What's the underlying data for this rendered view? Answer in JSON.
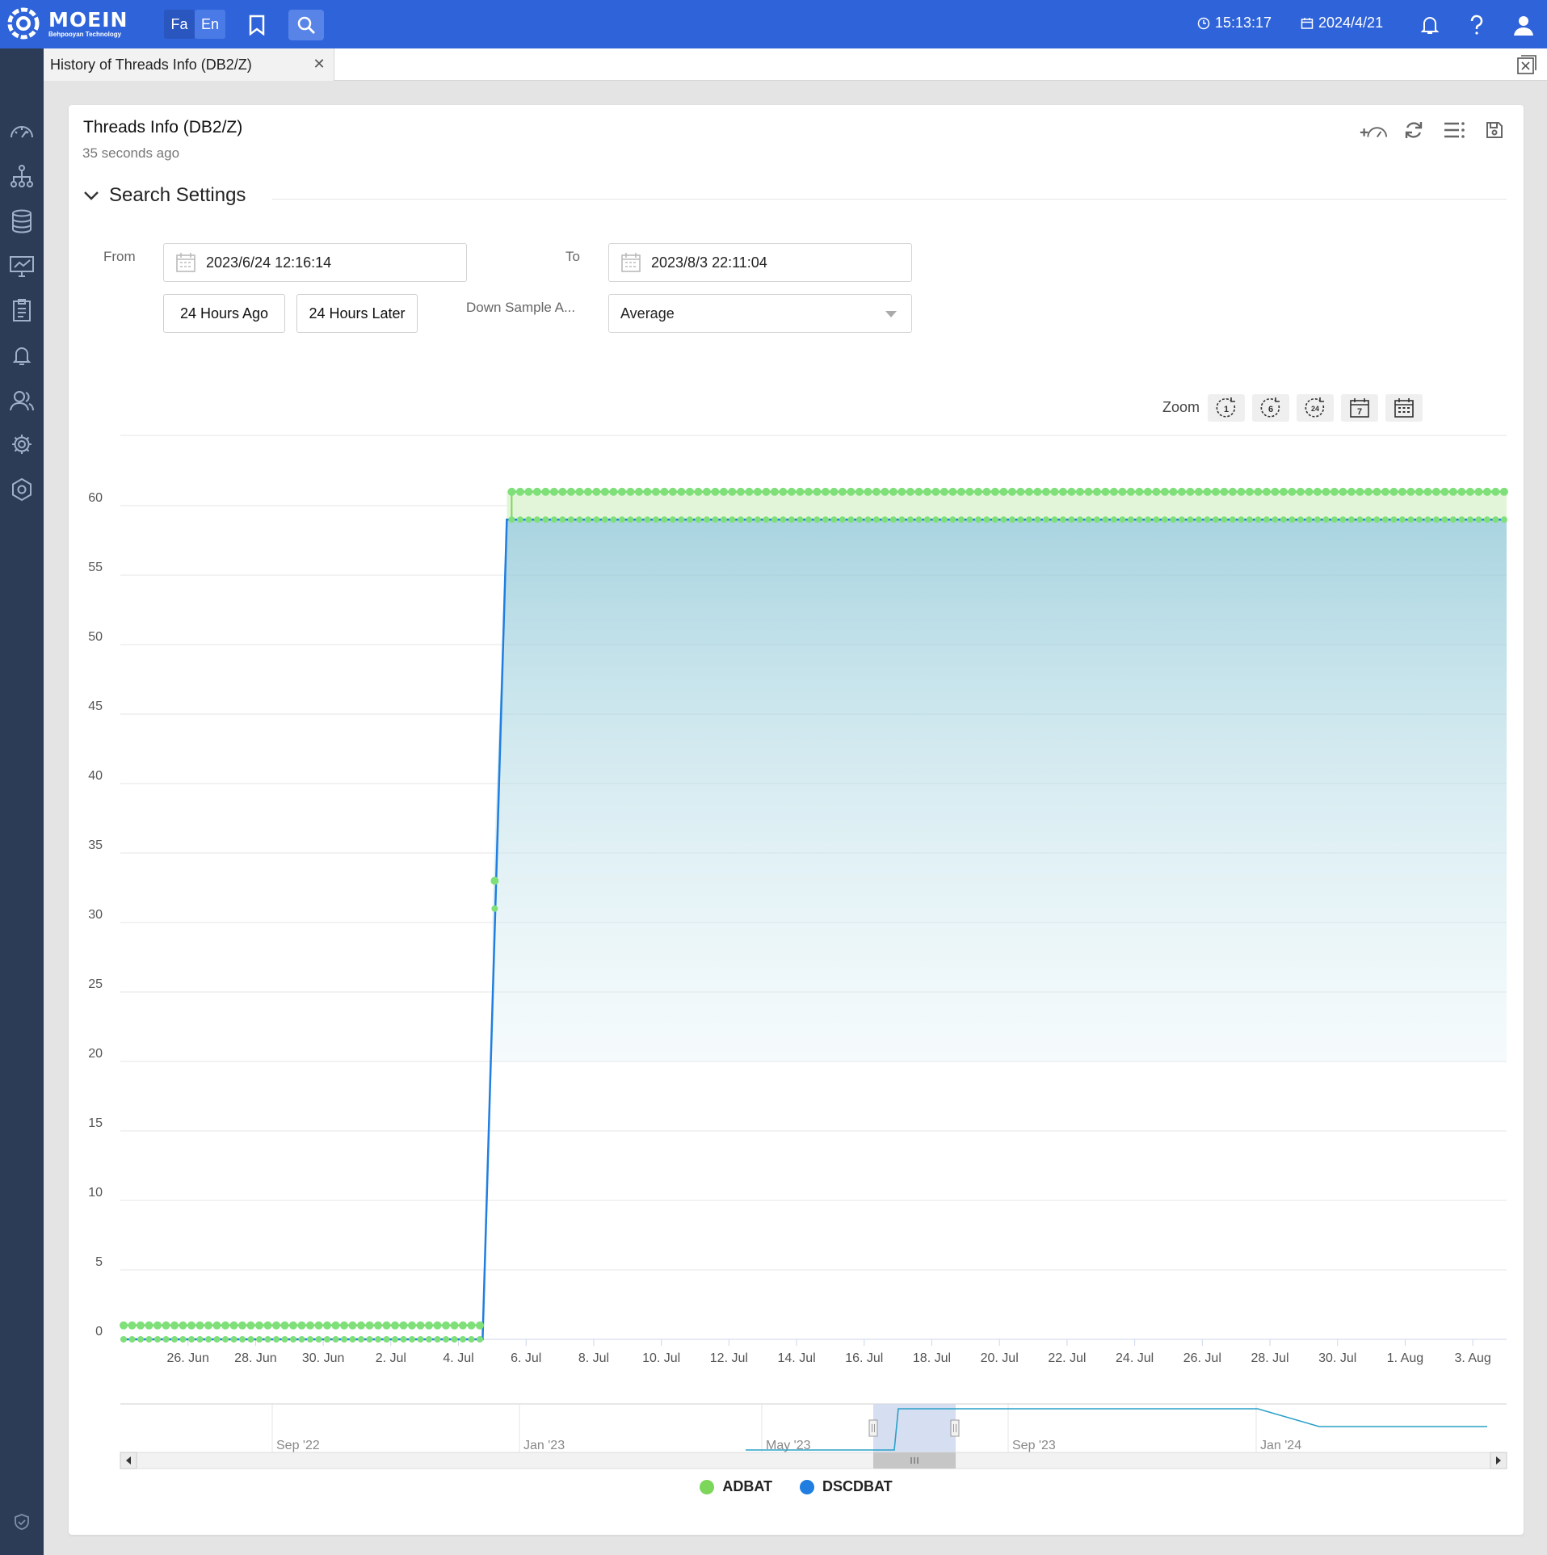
{
  "app": {
    "brand_name": "MOEIN",
    "brand_sub": "Behpooyan Technology",
    "lang_fa": "Fa",
    "lang_en": "En",
    "time": "15:13:17",
    "date": "2024/4/21"
  },
  "tab": {
    "title": "History of Threads Info (DB2/Z)"
  },
  "panel": {
    "title": "Threads Info (DB2/Z)",
    "subtitle": "35 seconds ago",
    "section_title": "Search Settings",
    "from_label": "From",
    "from_value": "2023/6/24 12:16:14",
    "to_label": "To",
    "to_value": "2023/8/3 22:11:04",
    "btn_ago": "24 Hours Ago",
    "btn_later": "24 Hours Later",
    "downsample_label": "Down Sample A...",
    "downsample_value": "Average",
    "zoom_label": "Zoom"
  },
  "colors": {
    "primary": "#2f63d9",
    "sidebar": "#2c3c57",
    "adbat": "#7bd65a",
    "dscdbat": "#1f7ee0"
  },
  "chart_data": {
    "type": "area",
    "title": "",
    "xlabel": "",
    "ylabel": "",
    "ylim": [
      0,
      65
    ],
    "yticks": [
      "0",
      "5",
      "10",
      "15",
      "20",
      "25",
      "30",
      "35",
      "40",
      "45",
      "50",
      "55",
      "60"
    ],
    "xticks": [
      "26. Jun",
      "28. Jun",
      "30. Jun",
      "2. Jul",
      "4. Jul",
      "6. Jul",
      "8. Jul",
      "10. Jul",
      "12. Jul",
      "14. Jul",
      "16. Jul",
      "18. Jul",
      "20. Jul",
      "22. Jul",
      "24. Jul",
      "26. Jul",
      "28. Jul",
      "30. Jul",
      "1. Aug",
      "3. Aug"
    ],
    "xlim": [
      "2023-06-24",
      "2023-08-04"
    ],
    "series": [
      {
        "name": "ADBAT",
        "segments": [
          {
            "x_from": "2023-06-24",
            "x_to": "2023-07-05",
            "value": 1
          },
          {
            "x": "2023-07-05",
            "value": 33
          },
          {
            "x_from": "2023-07-05",
            "x_to": "2023-08-04",
            "value": 61
          }
        ]
      },
      {
        "name": "DSCDBAT",
        "segments": [
          {
            "x_from": "2023-06-24",
            "x_to": "2023-07-05",
            "value": 0
          },
          {
            "x": "2023-07-05",
            "value": 31
          },
          {
            "x_from": "2023-07-05",
            "x_to": "2023-08-04",
            "value": 59
          }
        ]
      }
    ],
    "navigator_labels": [
      "Sep '22",
      "Jan '23",
      "May '23",
      "Sep '23",
      "Jan '24"
    ],
    "legend": [
      "ADBAT",
      "DSCDBAT"
    ],
    "legend_position": "bottom"
  }
}
